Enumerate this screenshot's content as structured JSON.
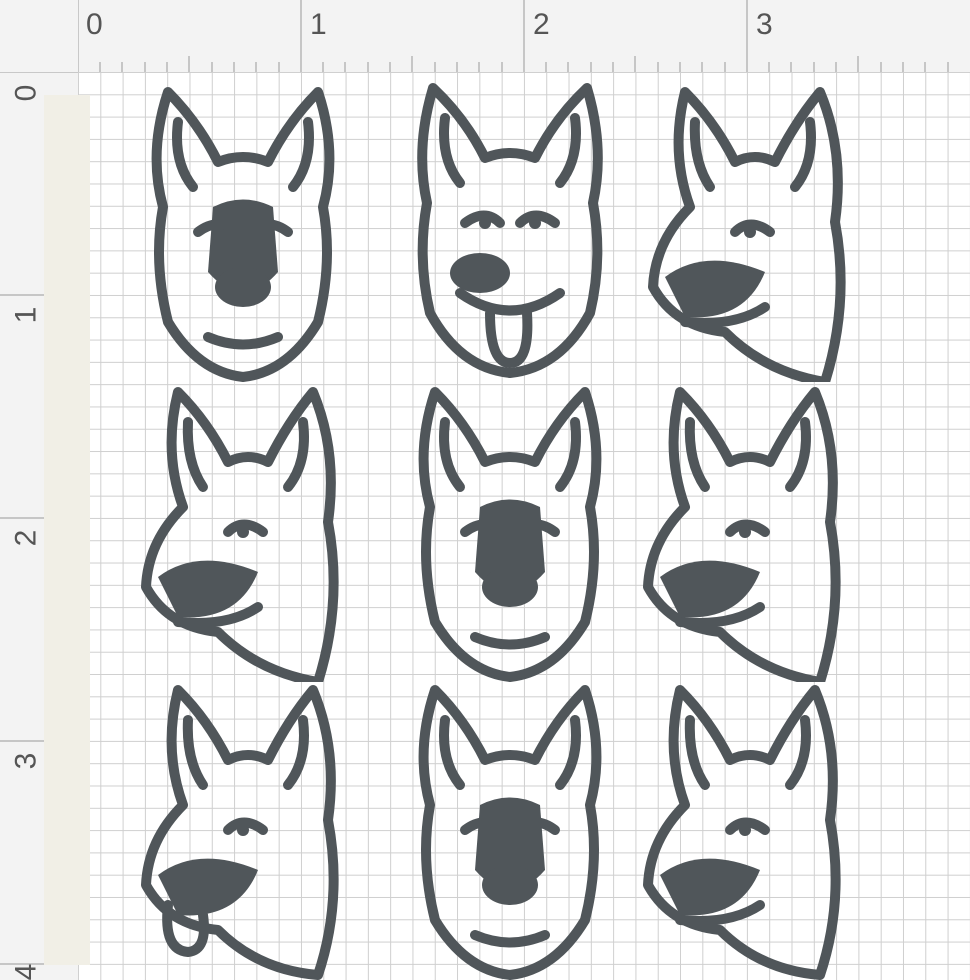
{
  "ruler": {
    "top_labels": [
      "0",
      "1",
      "2",
      "3"
    ],
    "left_labels": [
      "0",
      "1",
      "2",
      "3",
      "4"
    ]
  },
  "colors": {
    "ink": "#50565a",
    "grid": "#cfcfcf",
    "ruler_bg": "#f3f3f3",
    "mat_strip": "#f1efe6"
  },
  "designs": [
    {
      "icon": "shepherd-head-front-icon"
    },
    {
      "icon": "shepherd-head-tongue-icon"
    },
    {
      "icon": "shepherd-head-profile-icon"
    },
    {
      "icon": "shepherd-head-profile-icon"
    },
    {
      "icon": "shepherd-head-front-icon"
    },
    {
      "icon": "shepherd-head-profile-icon"
    },
    {
      "icon": "shepherd-head-tongue-icon"
    },
    {
      "icon": "shepherd-head-front-icon"
    },
    {
      "icon": "shepherd-head-profile-icon"
    }
  ]
}
